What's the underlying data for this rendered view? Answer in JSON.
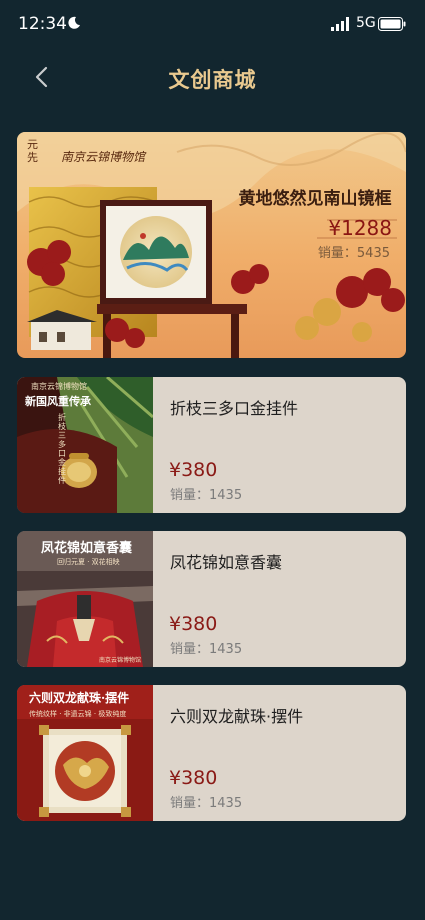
{
  "status_bar": {
    "time": "12:34",
    "network": "5G"
  },
  "header": {
    "title": "文创商城"
  },
  "featured": {
    "name": "黄地悠然见南山镜框",
    "price": "¥1288",
    "sales": "销量：5435",
    "brand_logo": "南京云锦博物馆",
    "brand_mark": "元先"
  },
  "products": [
    {
      "name": "折枝三多口金挂件",
      "price": "¥380",
      "sales": "销量：1435",
      "thumb_title": "新国风重传承",
      "thumb_logo": "南京云锦博物馆",
      "thumb_vertical": "折枝三多口金挂件"
    },
    {
      "name": "凤花锦如意香囊",
      "price": "¥380",
      "sales": "销量：1435",
      "thumb_title": "凤花锦如意香囊",
      "thumb_sub": "回归元夏 · 双花相映",
      "thumb_logo": "南京云锦博物馆"
    },
    {
      "name": "六则双龙献珠·摆件",
      "price": "¥380",
      "sales": "销量：1435",
      "thumb_title": "六则双龙献珠·摆件",
      "thumb_sub": "传统纹样 · 非遗云锦 · 极致纯度"
    }
  ]
}
